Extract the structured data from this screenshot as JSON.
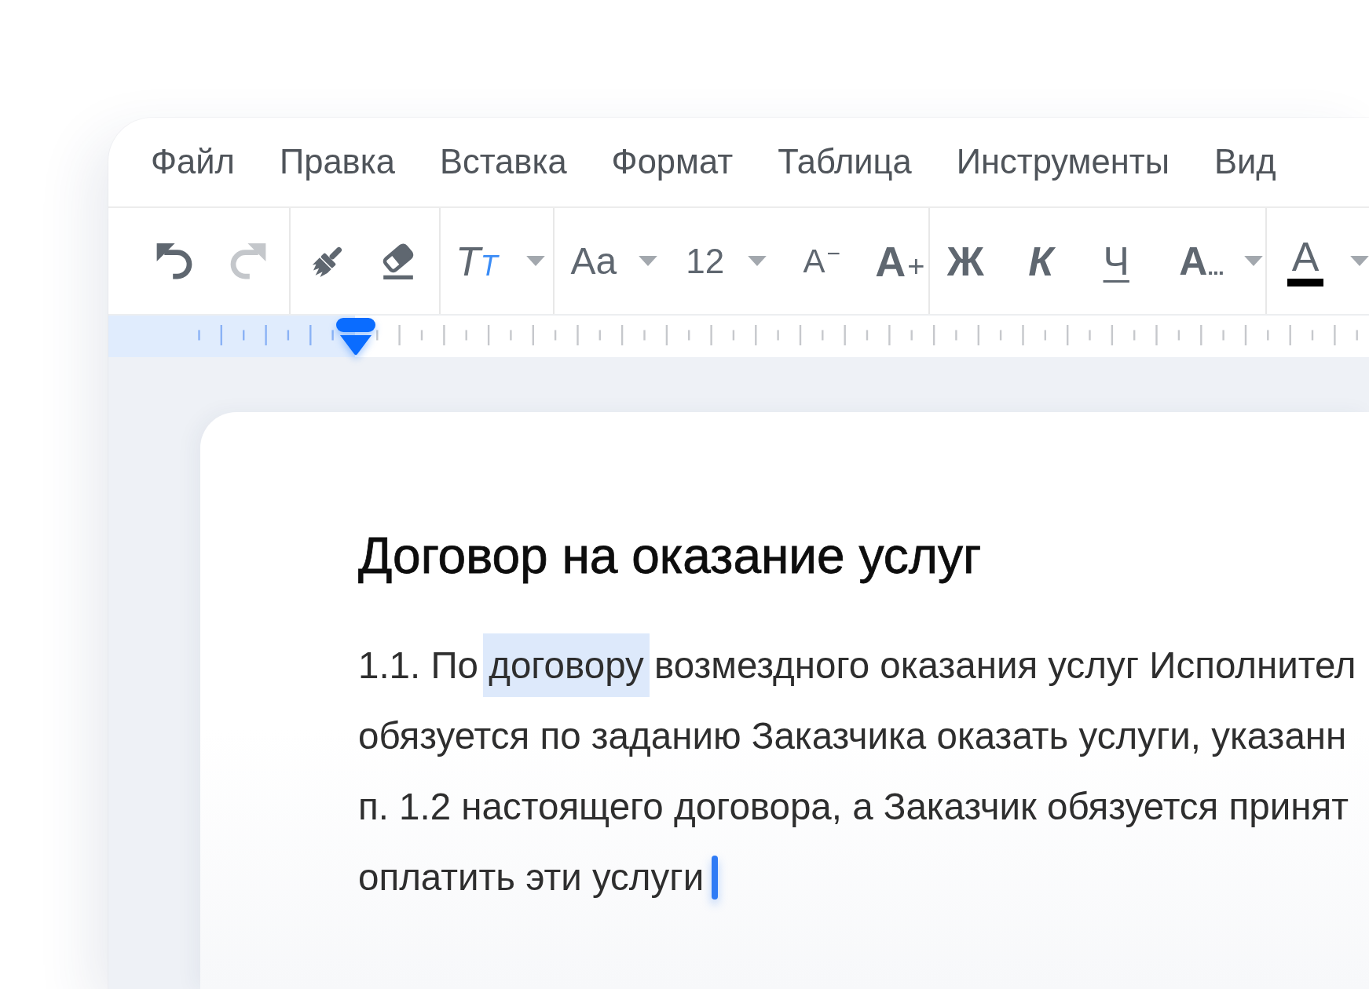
{
  "menu": {
    "items": [
      "Файл",
      "Правка",
      "Вставка",
      "Формат",
      "Таблица",
      "Инструменты",
      "Вид"
    ]
  },
  "toolbar": {
    "groups": [
      {
        "items": [
          {
            "kind": "undo",
            "disabled": false
          },
          {
            "kind": "redo",
            "disabled": true
          }
        ]
      },
      {
        "items": [
          {
            "kind": "brush",
            "disabled": false
          },
          {
            "kind": "eraser",
            "disabled": false
          }
        ]
      },
      {
        "items": [
          {
            "kind": "style",
            "label": "T",
            "accent_label": "T",
            "disabled": false
          }
        ]
      },
      {
        "items": [
          {
            "kind": "font",
            "label": "Aa",
            "disabled": false
          },
          {
            "kind": "size",
            "label": "12",
            "disabled": false
          },
          {
            "kind": "smaller",
            "label": "A",
            "suffix": "−",
            "disabled": false
          },
          {
            "kind": "larger",
            "label": "A",
            "suffix": "+",
            "disabled": false
          }
        ]
      },
      {
        "items": [
          {
            "kind": "bold",
            "label": "Ж",
            "disabled": false
          },
          {
            "kind": "italic",
            "label": "К",
            "disabled": false
          },
          {
            "kind": "underline",
            "label": "Ч",
            "disabled": false
          },
          {
            "kind": "highlight",
            "label": "A",
            "suffix": "...",
            "disabled": false
          }
        ]
      },
      {
        "items": [
          {
            "kind": "color",
            "label": "A",
            "color": "#000000",
            "disabled": false
          }
        ]
      }
    ]
  },
  "document": {
    "title": "Договор на оказание услуг",
    "paragraph": {
      "lines": [
        {
          "segments": [
            {
              "text": "1.1. По ",
              "selected": false
            },
            {
              "text": "договору",
              "selected": true
            },
            {
              "text": " возмездного оказания услуг Исполнител",
              "selected": false
            }
          ]
        },
        {
          "segments": [
            {
              "text": "обязуется по заданию Заказчика оказать услуги, указанн",
              "selected": false
            }
          ]
        },
        {
          "segments": [
            {
              "text": "п. 1.2 настоящего договора, а Заказчик обязуется принят",
              "selected": false
            }
          ]
        },
        {
          "segments": [
            {
              "text": "оплатить эти услуги",
              "selected": false
            }
          ]
        }
      ],
      "caret": true
    }
  }
}
